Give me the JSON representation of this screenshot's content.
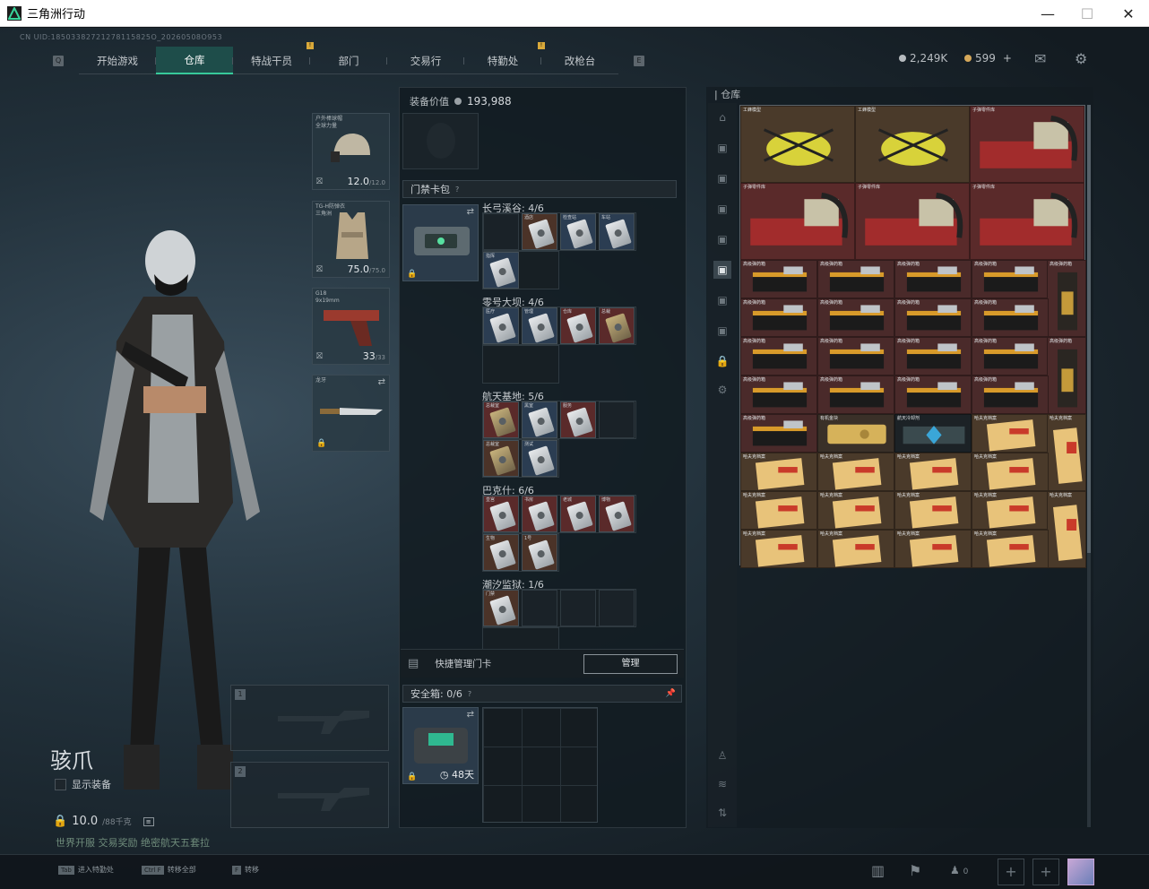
{
  "window": {
    "title": "三角洲行动",
    "minimize": "—",
    "maximize": "☐",
    "close": "✕"
  },
  "uid": "CN UID:18503382721278115825O_20260508O953",
  "tabs": [
    {
      "label": "开始游戏",
      "badge": ""
    },
    {
      "label": "仓库",
      "badge": "",
      "active": true
    },
    {
      "label": "特战干员",
      "badge": "!"
    },
    {
      "label": "部门",
      "badge": ""
    },
    {
      "label": "交易行",
      "badge": ""
    },
    {
      "label": "特勤处",
      "badge": "!"
    },
    {
      "label": "改枪台",
      "badge": ""
    }
  ],
  "currency": {
    "silver": "2,249K",
    "gold": "599",
    "plus": "+"
  },
  "operator": {
    "name": "骇爪",
    "show_equipment": "显示装备",
    "weight": "10.0",
    "weight_max": "/88千克",
    "hint": "世界开服 交易奖励 绝密航天五套拉"
  },
  "equipment": [
    {
      "label": "户外棒球帽\n全球力量",
      "value": "12.0",
      "max": "/12.0"
    },
    {
      "label": "TG-H防弹衣\n三角洲",
      "value": "75.0",
      "max": "/75.0"
    },
    {
      "label": "G18\n9x19mm",
      "value": "33",
      "max": "/33"
    },
    {
      "label": "龙牙",
      "value": "",
      "max": ""
    }
  ],
  "weapon_slots": [
    "1",
    "2"
  ],
  "loadout": {
    "label": "装备价值",
    "value": "193,988"
  },
  "keycard_bag": {
    "title": "门禁卡包",
    "help": "?",
    "groups": [
      {
        "name": "长弓溪谷: 4/6",
        "cards": [
          {
            "label": "",
            "color": "empty"
          },
          {
            "label": "酒店",
            "color": "brown"
          },
          {
            "label": "检查站",
            "color": "blue"
          },
          {
            "label": "车站",
            "color": "blue"
          },
          {
            "label": "指挥",
            "color": "blue"
          }
        ]
      },
      {
        "name": "零号大坝: 4/6",
        "cards": [
          {
            "label": "医疗",
            "color": "blue"
          },
          {
            "label": "管理",
            "color": "blue"
          },
          {
            "label": "仓库",
            "color": "red"
          },
          {
            "label": "总裁",
            "color": "red",
            "gold": true
          }
        ]
      },
      {
        "name": "航天基地: 5/6",
        "cards": [
          {
            "label": "总裁室",
            "color": "red",
            "gold": true
          },
          {
            "label": "黑室",
            "color": "blue"
          },
          {
            "label": "服务",
            "color": "red"
          },
          {
            "label": "",
            "color": "empty"
          },
          {
            "label": "总裁室",
            "color": "brown",
            "gold": true
          },
          {
            "label": "测试",
            "color": "blue"
          }
        ]
      },
      {
        "name": "巴克什: 6/6",
        "cards": [
          {
            "label": "皇宫",
            "color": "red"
          },
          {
            "label": "书房",
            "color": "red"
          },
          {
            "label": "老城",
            "color": "red"
          },
          {
            "label": "博物",
            "color": "red"
          },
          {
            "label": "生物",
            "color": "brown"
          },
          {
            "label": "1号",
            "color": "brown"
          }
        ]
      },
      {
        "name": "潮汐监狱: 1/6",
        "cards": [
          {
            "label": "门禁",
            "color": "brown"
          },
          {
            "label": "",
            "color": "empty"
          },
          {
            "label": "",
            "color": "empty"
          },
          {
            "label": "",
            "color": "empty"
          }
        ]
      }
    ]
  },
  "quick_manage": {
    "label": "快捷管理门卡",
    "button": "管理"
  },
  "safebox": {
    "title": "安全箱: 0/6",
    "help": "?",
    "days": "48天"
  },
  "warehouse": {
    "title": "仓库",
    "rows": [
      [
        "工蜂模型",
        "工蜂模型",
        "子弹零件库"
      ],
      [
        "子弹零件库",
        "子弹零件库",
        "子弹零件库"
      ],
      [
        "高级弹药箱",
        "高级弹药箱",
        "高级弹药箱",
        "高级弹药箱",
        "高级弹药箱"
      ],
      [
        "高级弹药箱",
        "高级弹药箱",
        "高级弹药箱",
        "高级弹药箱",
        ""
      ],
      [
        "高级弹药箱",
        "高级弹药箱",
        "高级弹药箱",
        "高级弹药箱",
        "高级弹药箱"
      ],
      [
        "高级弹药箱",
        "高级弹药箱",
        "高级弹药箱",
        "高级弹药箱",
        ""
      ],
      [
        "高级弹药箱",
        "有机金块",
        "航天冷却剂",
        "哈夫克档案",
        "哈夫克档案"
      ],
      [
        "哈夫克档案",
        "哈夫克档案",
        "哈夫克档案",
        "哈夫克档案",
        "哈夫克档案"
      ],
      [
        "哈夫克档案",
        "哈夫克档案",
        "哈夫克档案",
        "哈夫克档案",
        "哈夫克档案"
      ],
      [
        "哈夫克档案",
        "哈夫克档案",
        "哈夫克档案",
        "哈夫克档案",
        "哈夫克档案"
      ]
    ]
  },
  "bottom_keys": [
    {
      "key": "Tab",
      "label": "进入特勤处"
    },
    {
      "key": "Ctrl F",
      "label": "转移全部"
    },
    {
      "key": "F",
      "label": "转移"
    }
  ],
  "bottom_right": {
    "friends": "0"
  }
}
